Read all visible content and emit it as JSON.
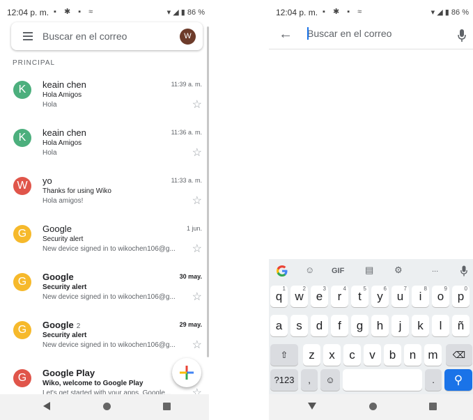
{
  "status": {
    "time": "12:04 p. m.",
    "battery": "86 %"
  },
  "left": {
    "search_placeholder": "Buscar en el correo",
    "account_initial": "W",
    "section_label": "PRINCIPAL",
    "emails": [
      {
        "initial": "K",
        "color": "#4caf7d",
        "sender": "keain chen",
        "count": "",
        "date": "11:39 a. m.",
        "subject": "Hola Amigos",
        "snippet": "Hola",
        "unread": false
      },
      {
        "initial": "K",
        "color": "#4caf7d",
        "sender": "keain chen",
        "count": "",
        "date": "11:36 a. m.",
        "subject": "Hola Amigos",
        "snippet": "Hola",
        "unread": false
      },
      {
        "initial": "W",
        "color": "#e0554a",
        "sender": "yo",
        "count": "",
        "date": "11:33 a. m.",
        "subject": "Thanks for using Wiko",
        "snippet": "Hola amigos!",
        "unread": false
      },
      {
        "initial": "G",
        "color": "#f6b92b",
        "sender": "Google",
        "count": "",
        "date": "1 jun.",
        "subject": "Security alert",
        "snippet": "New device signed in to wikochen106@g...",
        "unread": false
      },
      {
        "initial": "G",
        "color": "#f6b92b",
        "sender": "Google",
        "count": "",
        "date": "30 may.",
        "subject": "Security alert",
        "snippet": "New device signed in to wikochen106@g...",
        "unread": true
      },
      {
        "initial": "G",
        "color": "#f6b92b",
        "sender": "Google",
        "count": "2",
        "date": "29 may.",
        "subject": "Security alert",
        "snippet": "New device signed in to wikochen106@g...",
        "unread": true
      },
      {
        "initial": "G",
        "color": "#e0554a",
        "sender": "Google Play",
        "count": "",
        "date": "",
        "subject": "Wiko, welcome to Google Play",
        "snippet": "Let's get started with your apps. Google...",
        "unread": true
      }
    ]
  },
  "right": {
    "search_placeholder": "Buscar en el correo",
    "keyboard": {
      "row1": [
        "q",
        "w",
        "e",
        "r",
        "t",
        "y",
        "u",
        "i",
        "o",
        "p"
      ],
      "row1_hints": [
        "1",
        "2",
        "3",
        "4",
        "5",
        "6",
        "7",
        "8",
        "9",
        "0"
      ],
      "row2": [
        "a",
        "s",
        "d",
        "f",
        "g",
        "h",
        "j",
        "k",
        "l",
        "ñ"
      ],
      "row3": [
        "z",
        "x",
        "c",
        "v",
        "b",
        "n",
        "m"
      ],
      "symbols_key": "?123",
      "comma_key": ",",
      "period_key": ".",
      "gif_label": "GIF",
      "more_label": "..."
    }
  }
}
